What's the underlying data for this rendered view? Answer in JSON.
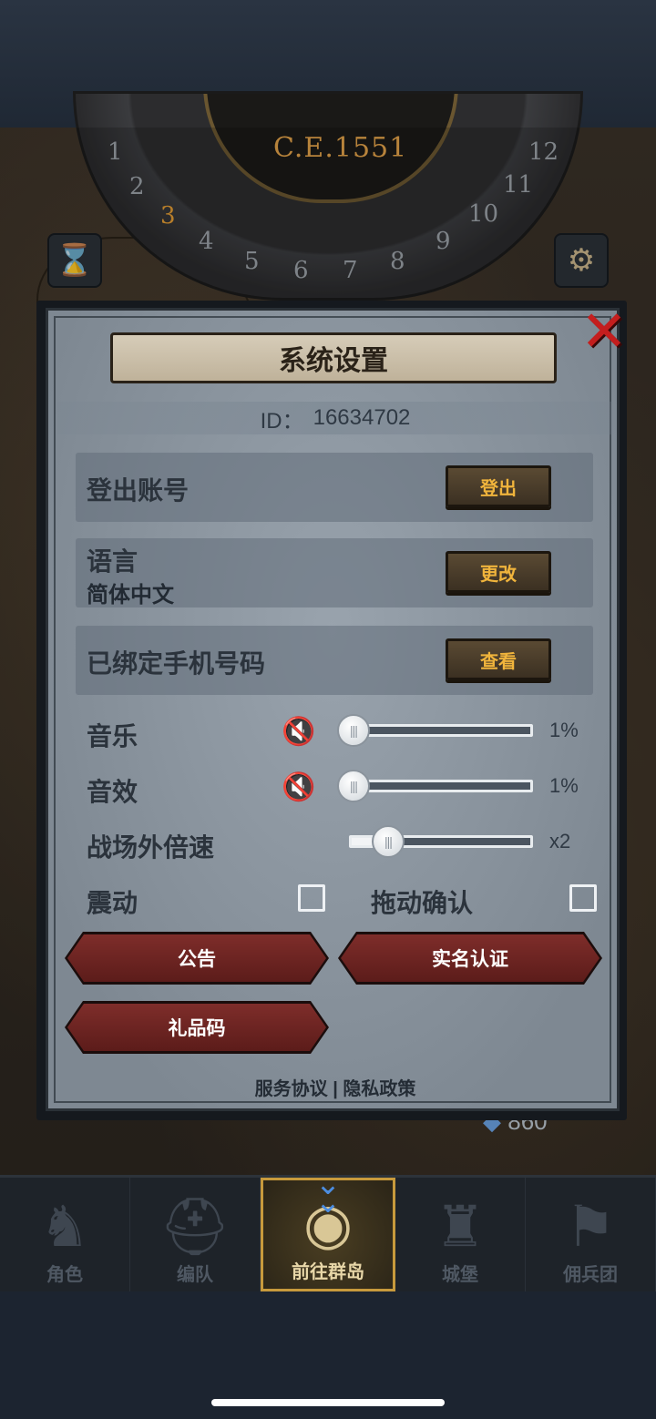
{
  "background": {
    "era": "C.E.1551",
    "dial_numbers": [
      "1",
      "2",
      "3",
      "4",
      "5",
      "6",
      "7",
      "8",
      "9",
      "10",
      "11",
      "12"
    ],
    "active_dial_number": "3",
    "resource_value": "860"
  },
  "dialog": {
    "title": "系统设置",
    "id_label": "ID：",
    "id_value": "16634702",
    "rows": {
      "logout": {
        "label": "登出账号",
        "button": "登出"
      },
      "language": {
        "label": "语言",
        "value": "简体中文",
        "button": "更改"
      },
      "phone": {
        "label": "已绑定手机号码",
        "button": "查看"
      }
    },
    "music": {
      "label": "音乐",
      "value_text": "1%",
      "level": 0.01
    },
    "sfx": {
      "label": "音效",
      "value_text": "1%",
      "level": 0.01
    },
    "speed": {
      "label": "战场外倍速",
      "value_text": "x2"
    },
    "vibration": {
      "label": "震动",
      "checked": false
    },
    "drag_confirm": {
      "label": "拖动确认",
      "checked": false
    },
    "buttons": {
      "notice": "公告",
      "realname": "实名认证",
      "giftcode": "礼品码"
    },
    "footer": {
      "service": "服务协议",
      "separator": "|",
      "privacy": "隐私政策"
    }
  },
  "nav": {
    "items": [
      {
        "label": "角色",
        "icon": "knight-icon"
      },
      {
        "label": "编队",
        "icon": "helmet-icon"
      },
      {
        "label": "前往群岛",
        "icon": "globe-icon"
      },
      {
        "label": "城堡",
        "icon": "castle-icon"
      },
      {
        "label": "佣兵团",
        "icon": "mercenary-icon"
      }
    ],
    "active_index": 2
  },
  "colors": {
    "accent_gold": "#f0b43c",
    "close_red": "#c41e1e",
    "button_red": "#7e2d2a",
    "nav_highlight": "#c79a3c"
  }
}
